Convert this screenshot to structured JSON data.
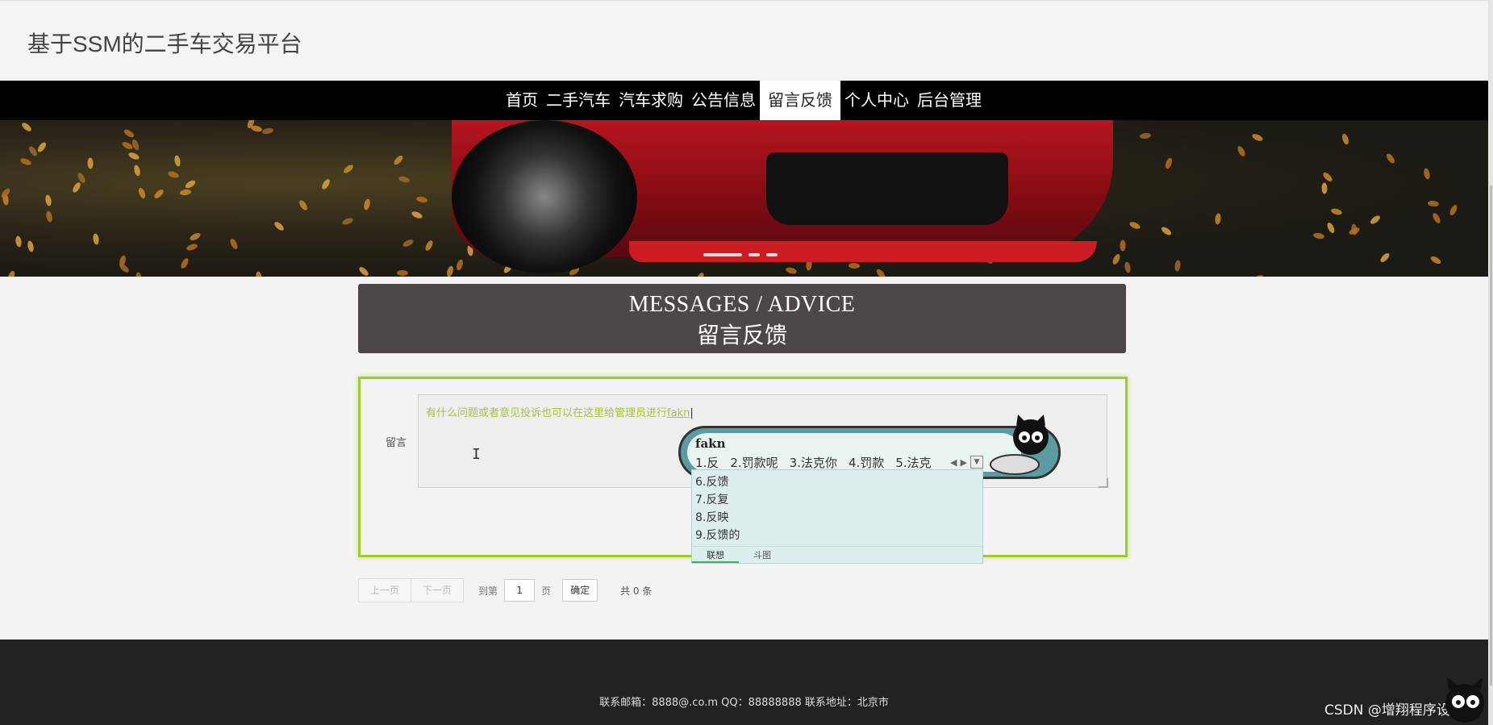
{
  "site": {
    "title": "基于SSM的二手车交易平台"
  },
  "nav": {
    "items": [
      {
        "label": "首页"
      },
      {
        "label": "二手汽车"
      },
      {
        "label": "汽车求购"
      },
      {
        "label": "公告信息"
      },
      {
        "label": "留言反馈",
        "active": true
      },
      {
        "label": "个人中心"
      },
      {
        "label": "后台管理"
      }
    ]
  },
  "banner": {
    "slides": 3,
    "active_slide": 1
  },
  "panel": {
    "title_en": "MESSAGES / ADVICE",
    "title_cn": "留言反馈"
  },
  "form": {
    "label": "留言",
    "placeholder": "有什么问题或者意见投诉也可以在这里给管理员进行",
    "typed": "fakn",
    "accent_color": "#9fcc2a"
  },
  "ime": {
    "pinyin": "fakn",
    "row1": [
      "1.反",
      "2.罚款呢",
      "3.法克你",
      "4.罚款",
      "5.法克"
    ],
    "candidates": [
      "6.反馈",
      "7.反复",
      "8.反映",
      "9.反馈的"
    ],
    "tabs": [
      "联想",
      "斗图"
    ]
  },
  "pager": {
    "prev": "上一页",
    "next": "下一页",
    "goto": "到第",
    "page": "1",
    "page_unit": "页",
    "ok": "确定",
    "total": "共 0 条"
  },
  "footer": {
    "text": "联系邮箱：8888@.co.m QQ：88888888 联系地址：北京市"
  },
  "watermark": "CSDN @增翔程序设计"
}
